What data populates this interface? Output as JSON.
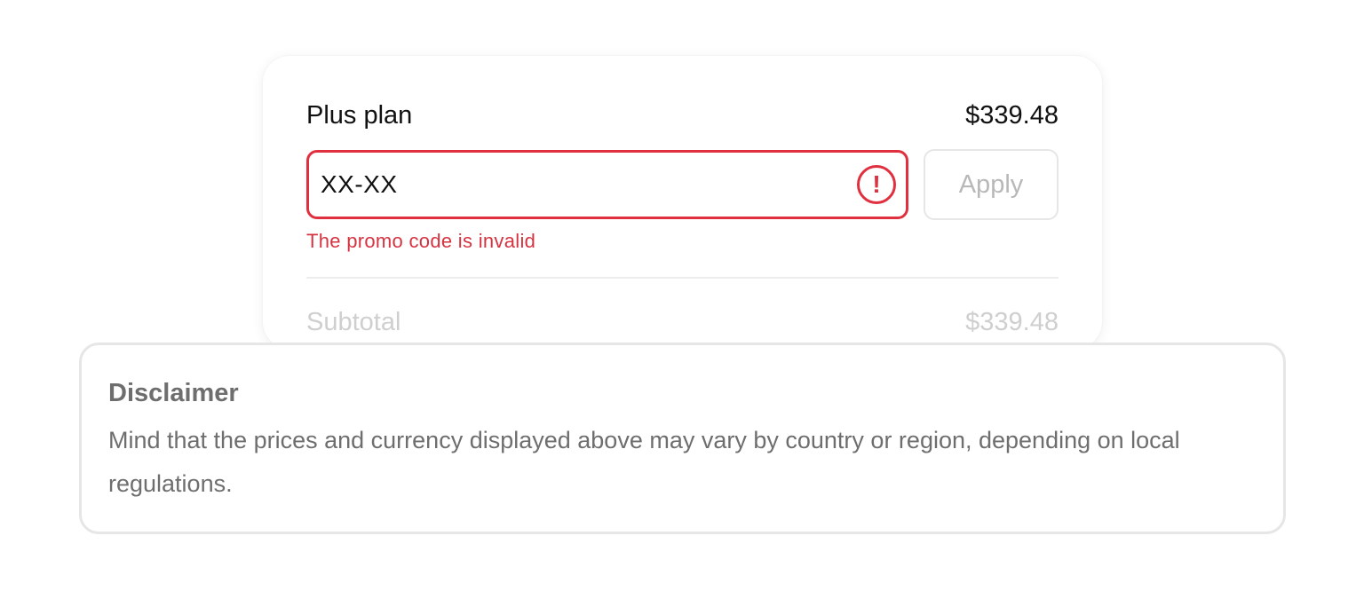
{
  "checkout": {
    "plan_name": "Plus plan",
    "plan_price": "$339.48",
    "promo": {
      "value": "XX-XX",
      "error_icon_glyph": "!",
      "error_message": "The promo code is invalid",
      "apply_label": "Apply"
    },
    "subtotal_label": "Subtotal",
    "subtotal_value": "$339.48"
  },
  "disclaimer": {
    "title": "Disclaimer",
    "body": "Mind that the prices and currency displayed above may vary by country or region, depending on local regulations."
  },
  "colors": {
    "error": "#e0303f",
    "error_text": "#d63341",
    "muted": "#b8b8b8",
    "disclaimer_text": "#6e6e6e"
  }
}
